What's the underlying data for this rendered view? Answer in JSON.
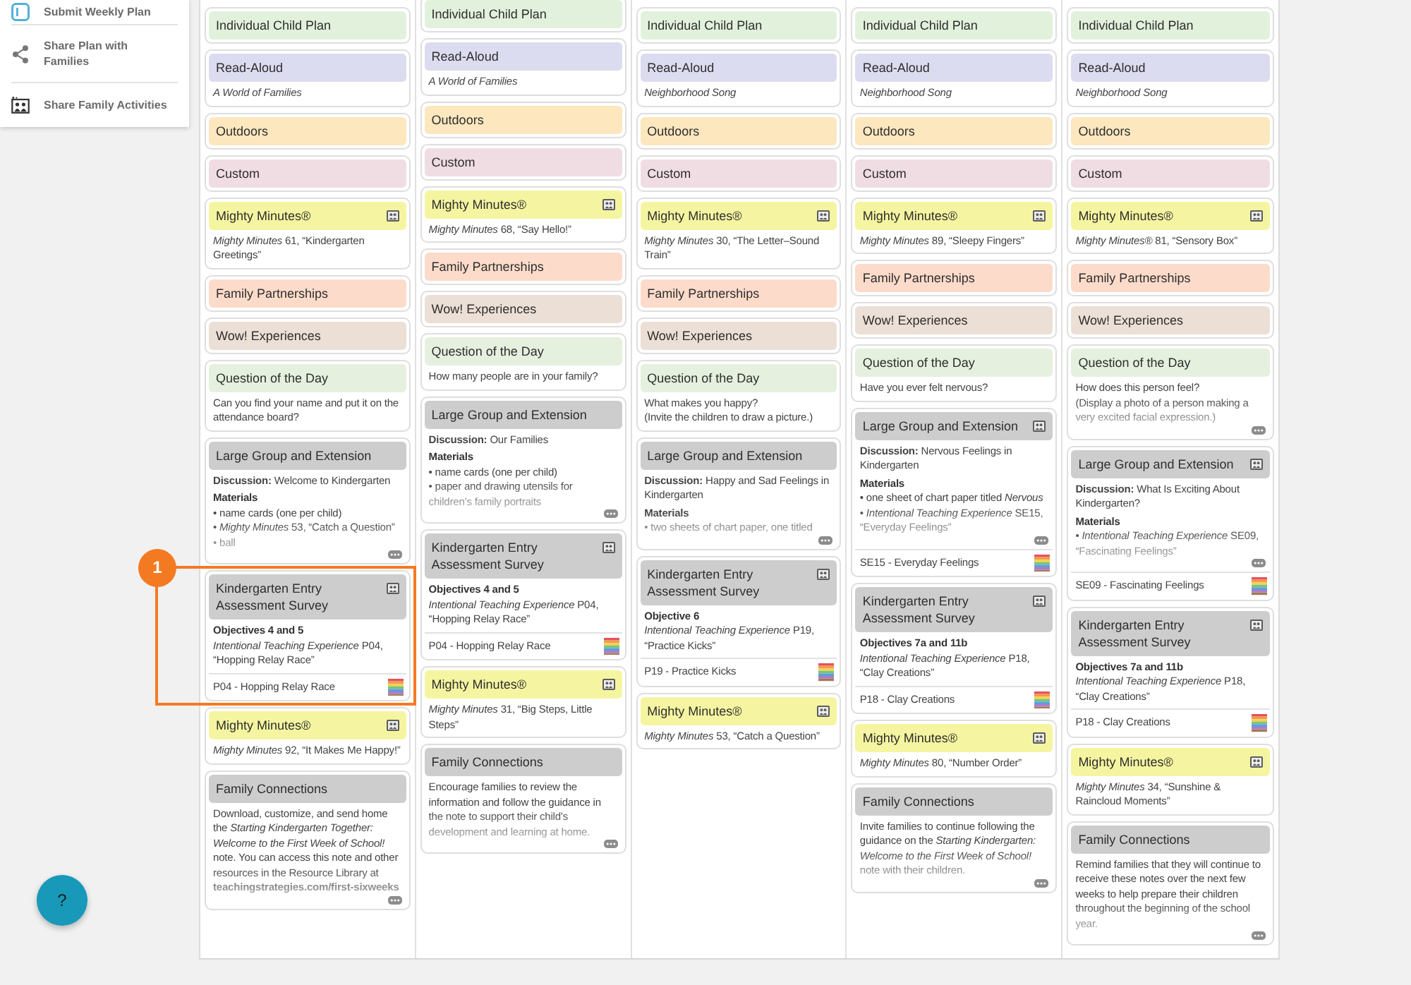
{
  "sidebar": {
    "items": [
      {
        "label": "Submit Weekly Plan"
      },
      {
        "label": "Share Plan with Families"
      },
      {
        "label": "Share Family Activities"
      }
    ]
  },
  "columns": [
    {
      "cards": [
        {
          "title": "Individual Child Plan",
          "color": "#e2f1dc"
        },
        {
          "title": "Read-Aloud",
          "color": "#dcdcf0",
          "body": [
            {
              "kind": "title",
              "text": "A World of Families"
            }
          ]
        },
        {
          "title": "Outdoors",
          "color": "#fde7bf"
        },
        {
          "title": "Custom",
          "color": "#f0dde4"
        },
        {
          "title": "Mighty Minutes®",
          "color": "#f5f5a1",
          "media_icon": true,
          "body": [
            {
              "kind": "text",
              "text": "*Mighty Minutes* 61, “Kindergarten Greetings”"
            }
          ]
        },
        {
          "title": "Family Partnerships",
          "color": "#fddbca"
        },
        {
          "title": "Wow! Experiences",
          "color": "#ecdfd5"
        },
        {
          "title": "Question of the Day",
          "color": "#e5f0de",
          "body": [
            {
              "kind": "text",
              "text": "Can you find your name and put it on the attendance board?"
            }
          ]
        },
        {
          "title": "Large Group and Extension",
          "color": "#cdcdcd",
          "body": [
            {
              "kind": "text",
              "text": "**Discussion:** Welcome to Kindergarten"
            },
            {
              "kind": "heading",
              "text": "Materials"
            },
            {
              "kind": "bullet",
              "text": "• name cards (one per child)"
            },
            {
              "kind": "bullet",
              "text": "• *Mighty Minutes* 53, “Catch a Question”"
            },
            {
              "kind": "bullet",
              "text": "• ball"
            }
          ],
          "truncated": true
        },
        {
          "title": "Kindergarten Entry Assessment Survey",
          "color": "#cdcdcd",
          "media_icon": true,
          "body": [
            {
              "kind": "heading",
              "text": "Objectives 4 and 5"
            },
            {
              "kind": "text",
              "text": "*Intentional Teaching Experience* P04, “Hopping Relay Race”"
            }
          ],
          "footer": "P04 - Hopping Relay Race"
        },
        {
          "title": "Mighty Minutes®",
          "color": "#f5f5a1",
          "media_icon": true,
          "body": [
            {
              "kind": "text",
              "text": "*Mighty Minutes* 92, “It Makes Me Happy!”"
            }
          ]
        },
        {
          "title": "Family Connections",
          "color": "#cdcdcd",
          "body": [
            {
              "kind": "text",
              "text": "Download, customize, and send home the *Starting Kindergarten Together: Welcome to the First Week of School!* note. You can access this note and other resources in the Resource Library at **teachingstrategies.com/first-sixweeks**"
            }
          ],
          "truncated": true
        }
      ]
    },
    {
      "cards": [
        {
          "title": "Individual Child Plan",
          "color": "#e2f1dc"
        },
        {
          "title": "Read-Aloud",
          "color": "#dcdcf0",
          "body": [
            {
              "kind": "title",
              "text": "A World of Families"
            }
          ]
        },
        {
          "title": "Outdoors",
          "color": "#fde7bf"
        },
        {
          "title": "Custom",
          "color": "#f0dde4"
        },
        {
          "title": "Mighty Minutes®",
          "color": "#f5f5a1",
          "media_icon": true,
          "body": [
            {
              "kind": "text",
              "text": "*Mighty Minutes* 68, “Say Hello!”"
            }
          ]
        },
        {
          "title": "Family Partnerships",
          "color": "#fddbca"
        },
        {
          "title": "Wow! Experiences",
          "color": "#ecdfd5"
        },
        {
          "title": "Question of the Day",
          "color": "#e5f0de",
          "body": [
            {
              "kind": "text",
              "text": "How many people are in your family?"
            }
          ]
        },
        {
          "title": "Large Group and Extension",
          "color": "#cdcdcd",
          "body": [
            {
              "kind": "text",
              "text": "**Discussion:** Our Families"
            },
            {
              "kind": "heading",
              "text": "Materials"
            },
            {
              "kind": "bullet",
              "text": "• name cards (one per child)"
            },
            {
              "kind": "bullet",
              "text": "• paper and drawing utensils for children’s family portraits"
            }
          ],
          "truncated": true
        },
        {
          "title": "Kindergarten Entry Assessment Survey",
          "color": "#cdcdcd",
          "media_icon": true,
          "body": [
            {
              "kind": "heading",
              "text": "Objectives 4 and 5"
            },
            {
              "kind": "text",
              "text": "*Intentional Teaching Experience* P04, “Hopping Relay Race”"
            }
          ],
          "footer": "P04 - Hopping Relay Race"
        },
        {
          "title": "Mighty Minutes®",
          "color": "#f5f5a1",
          "media_icon": true,
          "body": [
            {
              "kind": "text",
              "text": "*Mighty Minutes* 31, “Big Steps, Little Steps”"
            }
          ]
        },
        {
          "title": "Family Connections",
          "color": "#cdcdcd",
          "body": [
            {
              "kind": "text",
              "text": "Encourage families to review the information and follow the guidance in the note to support their child’s development and learning at home."
            }
          ],
          "truncated": true
        }
      ]
    },
    {
      "cards": [
        {
          "title": "Individual Child Plan",
          "color": "#e2f1dc"
        },
        {
          "title": "Read-Aloud",
          "color": "#dcdcf0",
          "body": [
            {
              "kind": "title",
              "text": "Neighborhood Song"
            }
          ]
        },
        {
          "title": "Outdoors",
          "color": "#fde7bf"
        },
        {
          "title": "Custom",
          "color": "#f0dde4"
        },
        {
          "title": "Mighty Minutes®",
          "color": "#f5f5a1",
          "media_icon": true,
          "body": [
            {
              "kind": "text",
              "text": "*Mighty Minutes* 30, “The Letter–Sound Train”"
            }
          ]
        },
        {
          "title": "Family Partnerships",
          "color": "#fddbca"
        },
        {
          "title": "Wow! Experiences",
          "color": "#ecdfd5"
        },
        {
          "title": "Question of the Day",
          "color": "#e5f0de",
          "body": [
            {
              "kind": "text",
              "text": "What makes you happy?"
            },
            {
              "kind": "text",
              "text": "(Invite the children to draw a picture.)"
            }
          ]
        },
        {
          "title": "Large Group and Extension",
          "color": "#cdcdcd",
          "body": [
            {
              "kind": "text",
              "text": "**Discussion:** Happy and Sad Feelings in Kindergarten"
            },
            {
              "kind": "heading",
              "text": "Materials"
            },
            {
              "kind": "bullet",
              "text": "• two sheets of chart paper, one titled"
            }
          ],
          "truncated": true
        },
        {
          "title": "Kindergarten Entry Assessment Survey",
          "color": "#cdcdcd",
          "media_icon": true,
          "body": [
            {
              "kind": "heading",
              "text": "Objective 6"
            },
            {
              "kind": "text",
              "text": "*Intentional Teaching Experience* P19, “Practice Kicks”"
            }
          ],
          "footer": "P19 - Practice Kicks"
        },
        {
          "title": "Mighty Minutes®",
          "color": "#f5f5a1",
          "media_icon": true,
          "body": [
            {
              "kind": "text",
              "text": "*Mighty Minutes* 53, “Catch a Question”"
            }
          ]
        }
      ]
    },
    {
      "cards": [
        {
          "title": "Individual Child Plan",
          "color": "#e2f1dc"
        },
        {
          "title": "Read-Aloud",
          "color": "#dcdcf0",
          "body": [
            {
              "kind": "title",
              "text": "Neighborhood Song"
            }
          ]
        },
        {
          "title": "Outdoors",
          "color": "#fde7bf"
        },
        {
          "title": "Custom",
          "color": "#f0dde4"
        },
        {
          "title": "Mighty Minutes®",
          "color": "#f5f5a1",
          "media_icon": true,
          "body": [
            {
              "kind": "text",
              "text": "*Mighty Minutes* 89, “Sleepy Fingers”"
            }
          ]
        },
        {
          "title": "Family Partnerships",
          "color": "#fddbca"
        },
        {
          "title": "Wow! Experiences",
          "color": "#ecdfd5"
        },
        {
          "title": "Question of the Day",
          "color": "#e5f0de",
          "body": [
            {
              "kind": "text",
              "text": "Have you ever felt nervous?"
            }
          ]
        },
        {
          "title": "Large Group and Extension",
          "color": "#cdcdcd",
          "media_icon": true,
          "body": [
            {
              "kind": "text",
              "text": "**Discussion:** Nervous Feelings in Kindergarten"
            },
            {
              "kind": "heading",
              "text": "Materials"
            },
            {
              "kind": "bullet",
              "text": "• one sheet of chart paper titled *Nervous*"
            },
            {
              "kind": "bullet",
              "text": "• *Intentional Teaching Experience* SE15, “Everyday Feelings”"
            }
          ],
          "truncated": true,
          "footer": "SE15 - Everyday Feelings"
        },
        {
          "title": "Kindergarten Entry Assessment Survey",
          "color": "#cdcdcd",
          "media_icon": true,
          "body": [
            {
              "kind": "heading",
              "text": "Objectives 7a and 11b"
            },
            {
              "kind": "text",
              "text": "*Intentional Teaching Experience* P18, “Clay Creations”"
            }
          ],
          "footer": "P18 - Clay Creations"
        },
        {
          "title": "Mighty Minutes®",
          "color": "#f5f5a1",
          "media_icon": true,
          "body": [
            {
              "kind": "text",
              "text": "*Mighty Minutes* 80, “Number Order”"
            }
          ]
        },
        {
          "title": "Family Connections",
          "color": "#cdcdcd",
          "body": [
            {
              "kind": "text",
              "text": "Invite families to continue following the guidance on the *Starting Kindergarten: Welcome to the First Week of School!* note with their children."
            }
          ],
          "truncated": true
        }
      ]
    },
    {
      "cards": [
        {
          "title": "Individual Child Plan",
          "color": "#e2f1dc"
        },
        {
          "title": "Read-Aloud",
          "color": "#dcdcf0",
          "body": [
            {
              "kind": "title",
              "text": "Neighborhood Song"
            }
          ]
        },
        {
          "title": "Outdoors",
          "color": "#fde7bf"
        },
        {
          "title": "Custom",
          "color": "#f0dde4"
        },
        {
          "title": "Mighty Minutes®",
          "color": "#f5f5a1",
          "media_icon": true,
          "body": [
            {
              "kind": "text",
              "text": "*Mighty Minutes®* 81, “Sensory Box”"
            }
          ]
        },
        {
          "title": "Family Partnerships",
          "color": "#fddbca"
        },
        {
          "title": "Wow! Experiences",
          "color": "#ecdfd5"
        },
        {
          "title": "Question of the Day",
          "color": "#e5f0de",
          "body": [
            {
              "kind": "text",
              "text": "How does this person feel?"
            },
            {
              "kind": "text",
              "text": "(Display a photo of a person making a very excited facial expression.)"
            }
          ],
          "truncated": true
        },
        {
          "title": "Large Group and Extension",
          "color": "#cdcdcd",
          "media_icon": true,
          "body": [
            {
              "kind": "text",
              "text": "**Discussion:** What Is Exciting About Kindergarten?"
            },
            {
              "kind": "heading",
              "text": "Materials"
            },
            {
              "kind": "bullet",
              "text": "• *Intentional Teaching Experience* SE09, “Fascinating Feelings”"
            }
          ],
          "truncated": true,
          "footer": "SE09 - Fascinating Feelings"
        },
        {
          "title": "Kindergarten Entry Assessment Survey",
          "color": "#cdcdcd",
          "media_icon": true,
          "body": [
            {
              "kind": "heading",
              "text": "Objectives 7a and 11b"
            },
            {
              "kind": "text",
              "text": "*Intentional Teaching Experience* P18, “Clay Creations”"
            }
          ],
          "footer": "P18 - Clay Creations"
        },
        {
          "title": "Mighty Minutes®",
          "color": "#f5f5a1",
          "media_icon": true,
          "body": [
            {
              "kind": "text",
              "text": "*Mighty Minutes* 34, “Sunshine & Raincloud Moments”"
            }
          ]
        },
        {
          "title": "Family Connections",
          "color": "#cdcdcd",
          "body": [
            {
              "kind": "text",
              "text": "Remind families that they will continue to receive these notes over the next few weeks to help prepare their children throughout the beginning of the school year."
            }
          ],
          "truncated": true
        }
      ]
    }
  ],
  "help_button": {
    "label": "?"
  },
  "callout": {
    "label": "1"
  }
}
